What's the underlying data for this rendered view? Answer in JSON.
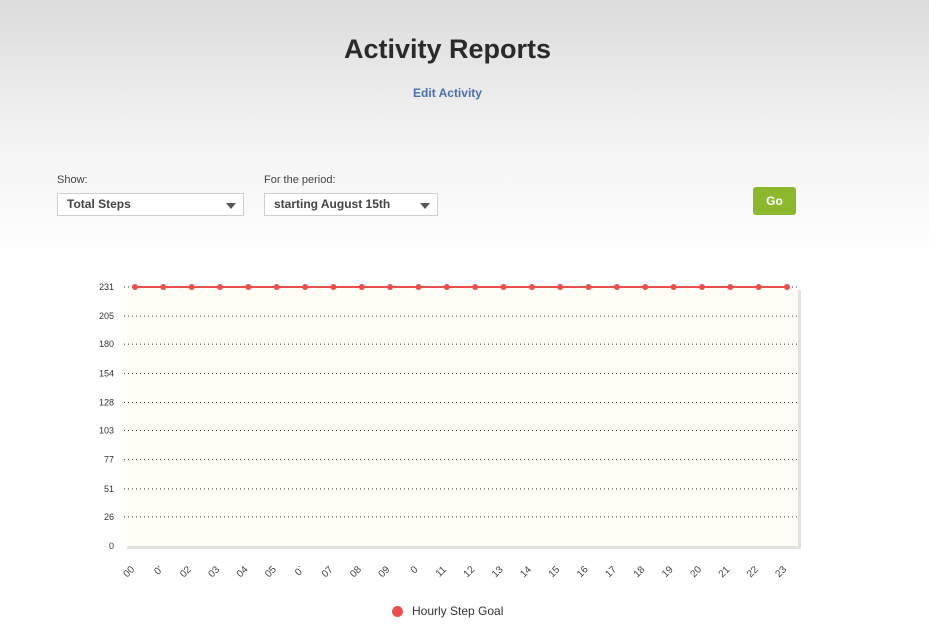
{
  "header": {
    "title": "Activity Reports",
    "edit_link": "Edit Activity"
  },
  "filters": {
    "show_label": "Show:",
    "show_value": "Total Steps",
    "period_label": "For the period:",
    "period_value": "starting August 15th",
    "go_label": "Go"
  },
  "colors": {
    "series": "#e8504e",
    "plot_bg": "#fffdf6",
    "go_button": "#8cb82e",
    "link": "#4a6fb0"
  },
  "chart_data": {
    "type": "line",
    "categories": [
      "00",
      "0'",
      "02",
      "03",
      "04",
      "05",
      "0`",
      "07",
      "08",
      "09",
      "0",
      "11",
      "12",
      "13",
      "14",
      "15",
      "16",
      "17",
      "18",
      "19",
      "20",
      "21",
      "22",
      "23"
    ],
    "y_ticks": [
      0,
      26,
      51,
      77,
      103,
      128,
      154,
      180,
      205,
      231
    ],
    "ylim": [
      0,
      231
    ],
    "grid": true,
    "legend_position": "bottom",
    "series": [
      {
        "name": "Hourly Step Goal",
        "values": [
          231,
          231,
          231,
          231,
          231,
          231,
          231,
          231,
          231,
          231,
          231,
          231,
          231,
          231,
          231,
          231,
          231,
          231,
          231,
          231,
          231,
          231,
          231,
          231
        ]
      }
    ]
  }
}
